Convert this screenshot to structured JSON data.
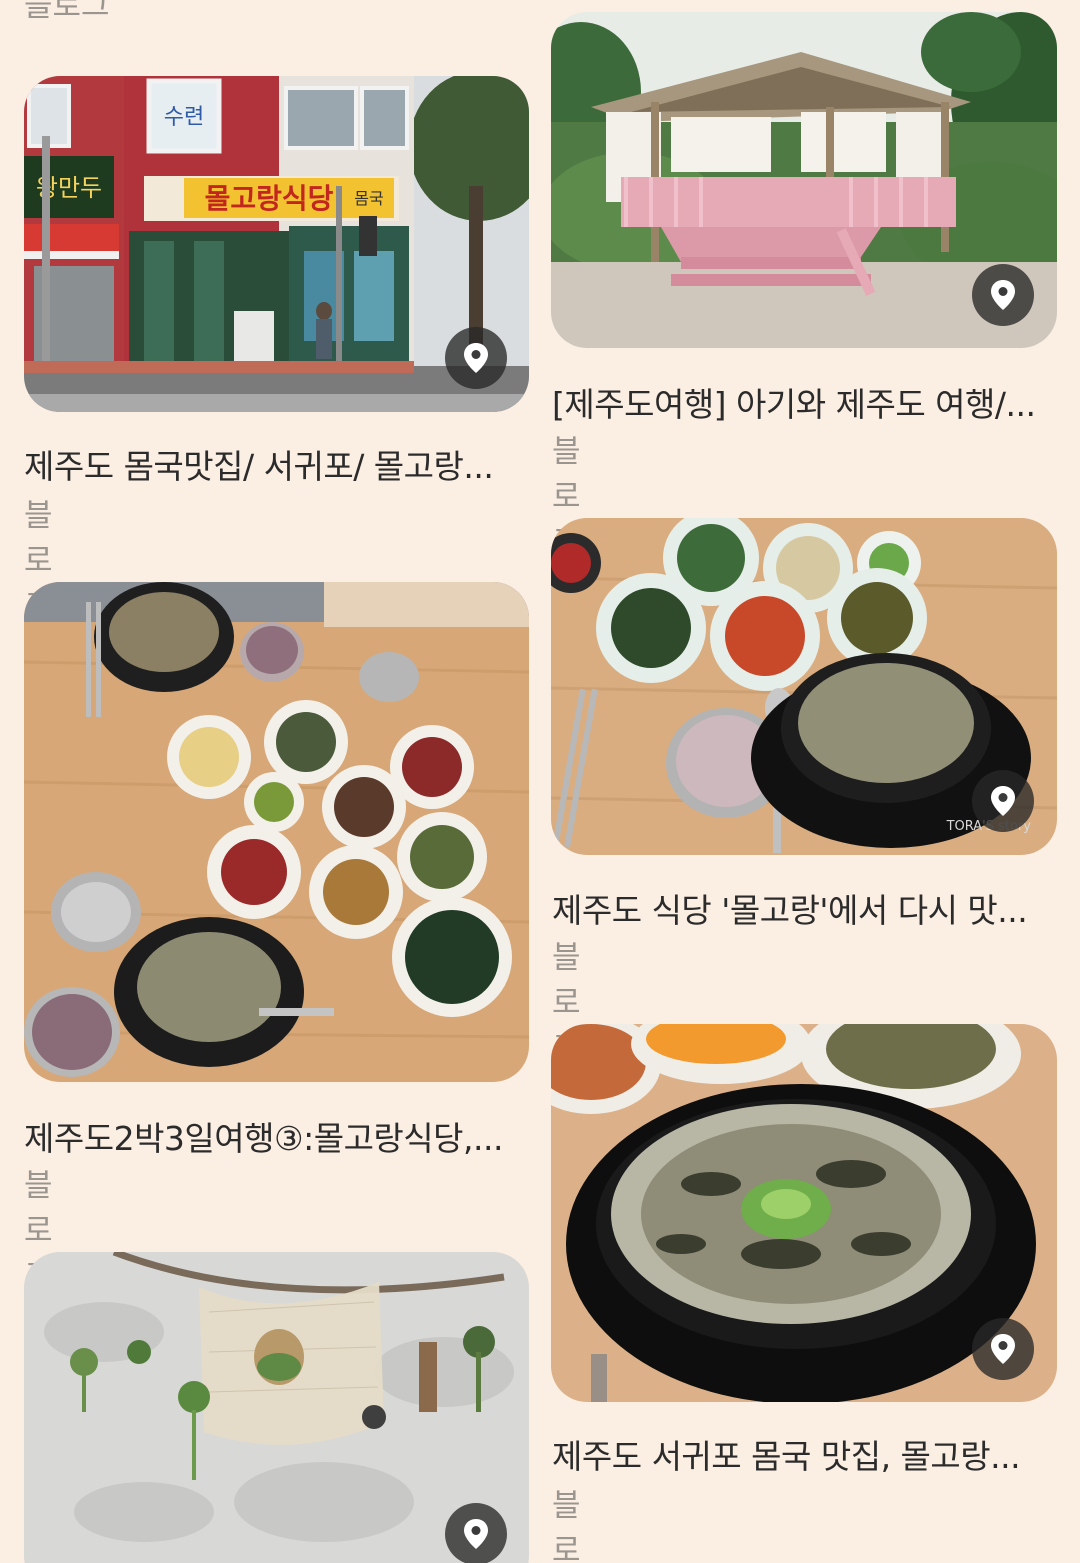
{
  "top_partial_source": "블로그",
  "cards": [
    {
      "title": "제주도 몸국맛집/ 서귀포/ 몰고랑...",
      "source": "블로그",
      "image": "restaurant-storefront-photo"
    },
    {
      "title": "[제주도여행] 아기와 제주도 여행/...",
      "source": "블로그",
      "image": "pink-gazebo-photo"
    },
    {
      "title": "제주도2박3일여행③:몰고랑식당,...",
      "source": "블로그",
      "image": "table-meal-photo"
    },
    {
      "title": "제주도 식당 '몰고랑'에서 다시 맛...",
      "source": "블로그",
      "image": "momguk-side-dishes-photo"
    },
    {
      "title": "제주도 서귀포 몸국 맛집, 몰고랑...",
      "source": "블로그",
      "image": "momguk-closeup-photo"
    },
    {
      "title": "",
      "source": "",
      "image": "wall-decor-photo"
    }
  ],
  "photo_text": {
    "sign_main": "몰고랑식당",
    "sign_sub": "몸국",
    "sign_left": "왕만두",
    "window_sign": "수련",
    "watermark": "TORA'S story"
  },
  "icons": {
    "location_pin": "location-pin-icon"
  },
  "colors": {
    "background": "#fbeee3",
    "title": "#2b2b2b",
    "source": "#9b9590"
  }
}
